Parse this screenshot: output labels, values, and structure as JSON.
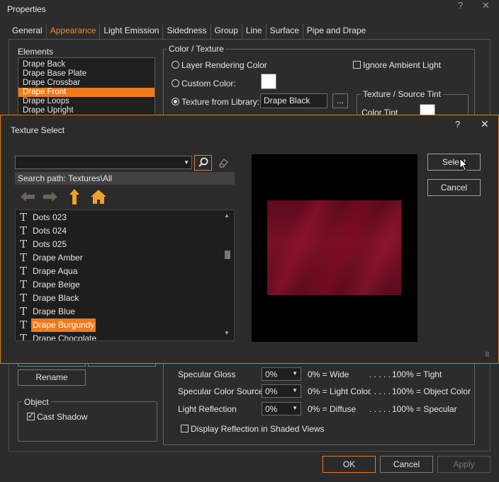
{
  "properties": {
    "title": "Properties",
    "help": "?",
    "close": "✕",
    "tabs": [
      "General",
      "Appearance",
      "Light Emission",
      "Sidedness",
      "Group",
      "Line",
      "Surface",
      "Pipe and Drape"
    ],
    "active_tab": "Appearance",
    "elements": {
      "legend": "Elements",
      "items": [
        "Drape Back",
        "Drape Base Plate",
        "Drape Crossbar",
        "Drape Front",
        "Drape Loops",
        "Drape Upright"
      ],
      "selected": "Drape Front",
      "rename_label": "Rename"
    },
    "color_texture": {
      "legend": "Color / Texture",
      "layer_rendering_color": "Layer Rendering Color",
      "custom_color": "Custom Color:",
      "texture_from_library": "Texture from Library:",
      "texture_value": "Drape Black",
      "browse_label": "...",
      "ignore_ambient": "Ignore Ambient Light",
      "tint_legend": "Texture / Source Tint",
      "color_tint": "Color Tint"
    },
    "surface": {
      "rows": [
        {
          "label": "Specular Gloss",
          "value": "0%",
          "low": "0% = Wide",
          "dots": ". . . . .",
          "high": "100% = Tight"
        },
        {
          "label": "Specular Color Source",
          "value": "0%",
          "low": "0% = Light Color",
          "dots": ". . . . .",
          "high": "100% = Object Color"
        },
        {
          "label": "Light Reflection",
          "value": "0%",
          "low": "0% = Diffuse",
          "dots": ". . . . .",
          "high": "100% = Specular"
        }
      ],
      "display_reflection": "Display Reflection in Shaded Views"
    },
    "object": {
      "legend": "Object",
      "cast_shadow": "Cast Shadow"
    },
    "buttons": {
      "ok": "OK",
      "cancel": "Cancel",
      "apply": "Apply"
    }
  },
  "texture_select": {
    "title": "Texture Select",
    "help": "?",
    "close": "✕",
    "search_value": "",
    "search_path": "Search path: Textures\\All",
    "items": [
      "Dots 023",
      "Dots 024",
      "Dots 025",
      "Drape Amber",
      "Drape Aqua",
      "Drape Beige",
      "Drape Black",
      "Drape Blue",
      "Drape Burgundy",
      "Drape Chocolate"
    ],
    "selected": "Drape Burgundy",
    "buttons": {
      "select": "Select",
      "cancel": "Cancel"
    }
  },
  "colors": {
    "accent": "#f07a1a",
    "background": "#2c2c2c",
    "preview_fabric": "#7a1028"
  },
  "icons": [
    "search-icon",
    "eraser-icon",
    "arrow-left-icon",
    "arrow-right-icon",
    "arrow-up-icon",
    "home-icon",
    "texture-t-icon",
    "mouse-cursor-icon",
    "resize-grip-icon"
  ]
}
